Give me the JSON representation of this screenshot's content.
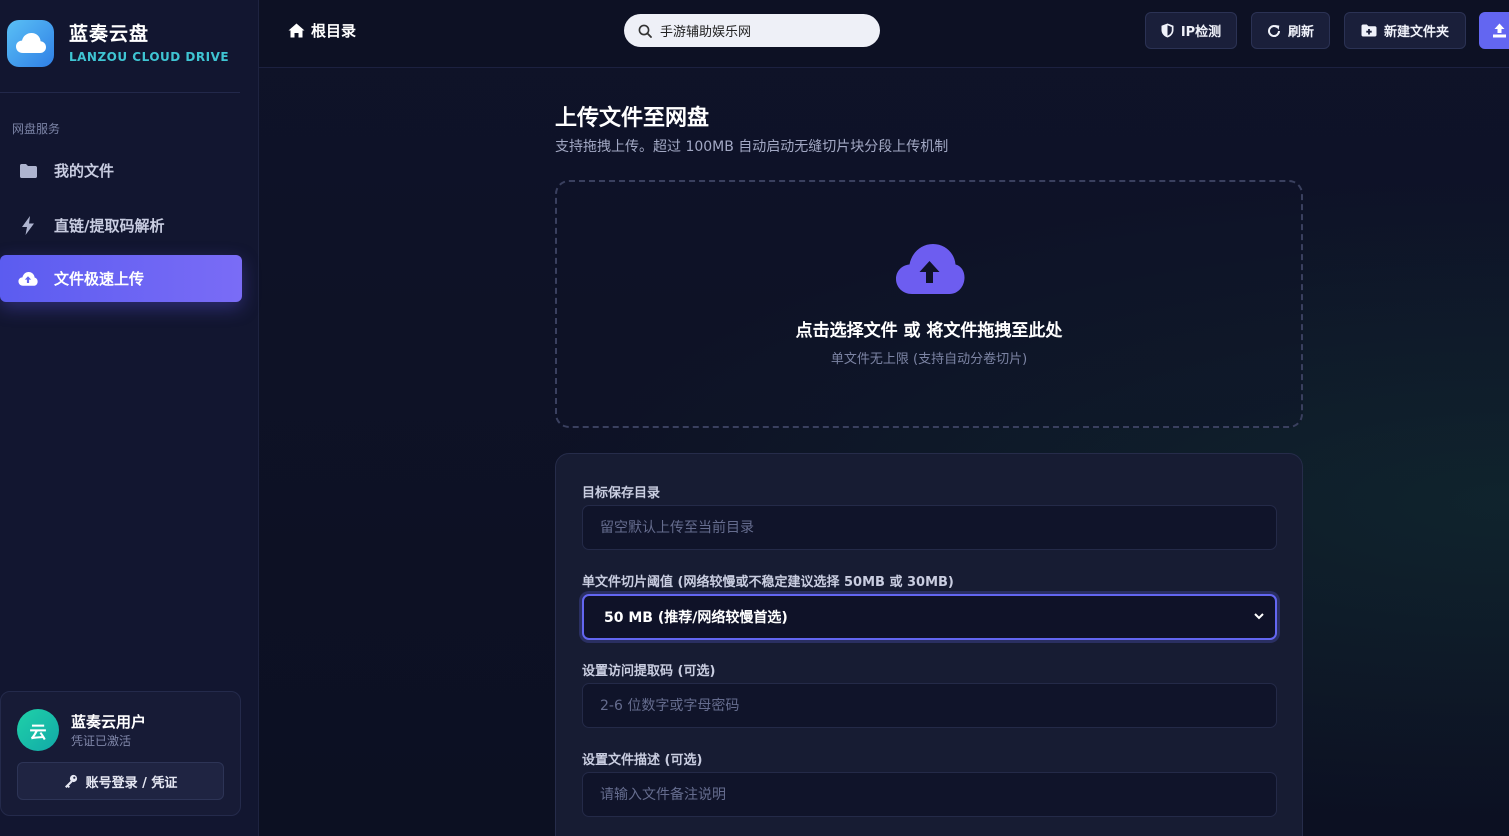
{
  "brand": {
    "name": "蓝奏云盘",
    "subtitle": "LANZOU CLOUD DRIVE"
  },
  "sidebar": {
    "section_label": "网盘服务",
    "items": [
      {
        "label": "我的文件",
        "icon": "folder-icon",
        "active": false
      },
      {
        "label": "直链/提取码解析",
        "icon": "bolt-icon",
        "active": false
      },
      {
        "label": "文件极速上传",
        "icon": "cloud-upload-icon",
        "active": true
      }
    ],
    "user": {
      "avatar_text": "云",
      "name": "蓝奏云用户",
      "status": "凭证已激活",
      "login_button": "账号登录 / 凭证"
    }
  },
  "header": {
    "breadcrumb": "根目录",
    "search": {
      "value": "手游辅助娱乐网",
      "placeholder": ""
    },
    "buttons": {
      "ip_check": "IP检测",
      "refresh": "刷新",
      "new_folder": "新建文件夹"
    }
  },
  "main": {
    "title": "上传文件至网盘",
    "subtitle": "支持拖拽上传。超过 100MB 自动启动无缝切片块分段上传机制",
    "dropzone": {
      "title": "点击选择文件 或 将文件拖拽至此处",
      "subtitle": "单文件无上限 (支持自动分卷切片)"
    },
    "form": {
      "target_dir": {
        "label": "目标保存目录",
        "value": "",
        "placeholder": "留空默认上传至当前目录"
      },
      "chunk_size": {
        "label": "单文件切片阈值 (网络较慢或不稳定建议选择 50MB 或 30MB)",
        "selected": "50 MB (推荐/网络较慢首选)"
      },
      "access_code": {
        "label": "设置访问提取码 (可选)",
        "value": "",
        "placeholder": "2-6 位数字或字母密码"
      },
      "description": {
        "label": "设置文件描述 (可选)",
        "value": "",
        "placeholder": "请输入文件备注说明"
      }
    }
  },
  "colors": {
    "accent": "#6366f1",
    "brand_cyan": "#3fc5d3",
    "avatar": "#1fd1a8",
    "background": "#0d1124"
  }
}
